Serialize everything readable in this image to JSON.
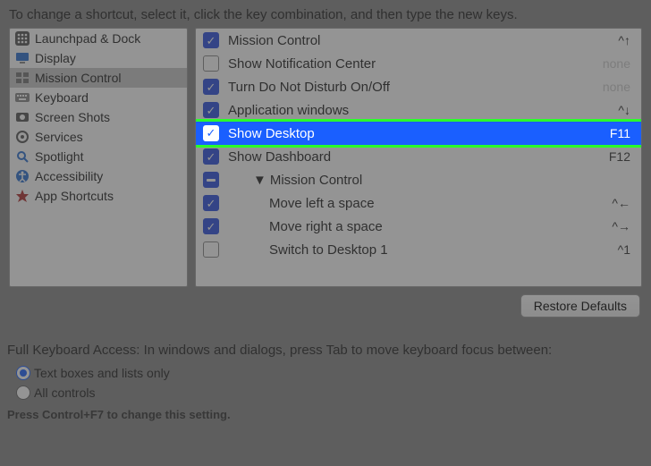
{
  "instruction": "To change a shortcut, select it, click the key combination, and then type the new keys.",
  "sidebar": {
    "items": [
      {
        "label": "Launchpad & Dock",
        "icon": "launchpad"
      },
      {
        "label": "Display",
        "icon": "display"
      },
      {
        "label": "Mission Control",
        "icon": "mission",
        "selected": true
      },
      {
        "label": "Keyboard",
        "icon": "keyboard"
      },
      {
        "label": "Screen Shots",
        "icon": "screenshot"
      },
      {
        "label": "Services",
        "icon": "services"
      },
      {
        "label": "Spotlight",
        "icon": "spotlight"
      },
      {
        "label": "Accessibility",
        "icon": "accessibility"
      },
      {
        "label": "App Shortcuts",
        "icon": "appshortcuts"
      }
    ]
  },
  "shortcuts": [
    {
      "checked": true,
      "label": "Mission Control",
      "shortcut": "^↑",
      "indent": 0
    },
    {
      "checked": false,
      "label": "Show Notification Center",
      "shortcut": "none",
      "indent": 0,
      "none": true
    },
    {
      "checked": true,
      "label": "Turn Do Not Disturb On/Off",
      "shortcut": "none",
      "indent": 0,
      "none": true
    },
    {
      "checked": true,
      "label": "Application windows",
      "shortcut": "^↓",
      "indent": 0
    },
    {
      "checked": true,
      "label": "Show Desktop",
      "shortcut": "F11",
      "indent": 0,
      "highlight": true
    },
    {
      "checked": true,
      "label": "Show Dashboard",
      "shortcut": "F12",
      "indent": 0
    },
    {
      "checked": "mixed",
      "label": "Mission Control",
      "shortcut": "",
      "indent": 1,
      "group": true
    },
    {
      "checked": true,
      "label": "Move left a space",
      "shortcut": "^←",
      "indent": 2
    },
    {
      "checked": true,
      "label": "Move right a space",
      "shortcut": "^→",
      "indent": 2
    },
    {
      "checked": false,
      "label": "Switch to Desktop 1",
      "shortcut": "^1",
      "indent": 2
    }
  ],
  "restore_label": "Restore Defaults",
  "kb_access": {
    "heading": "Full Keyboard Access: In windows and dialogs, press Tab to move keyboard focus between:",
    "opt1": "Text boxes and lists only",
    "opt2": "All controls",
    "selected": 1,
    "hint": "Press Control+F7 to change this setting."
  }
}
